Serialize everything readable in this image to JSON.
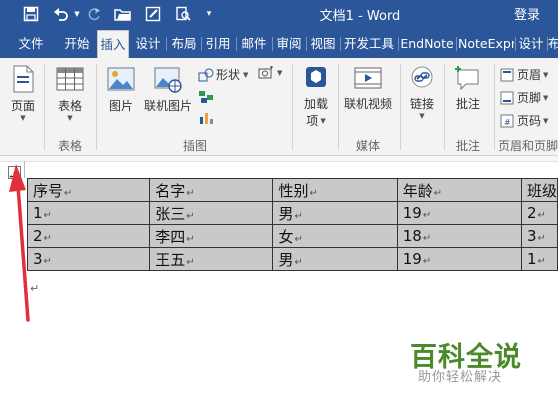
{
  "window": {
    "title": "文档1 - Word",
    "login": "登录"
  },
  "tabs": [
    {
      "label": "文件"
    },
    {
      "label": "开始"
    },
    {
      "label": "插入"
    },
    {
      "label": "设计"
    },
    {
      "label": "布局"
    },
    {
      "label": "引用"
    },
    {
      "label": "邮件"
    },
    {
      "label": "审阅"
    },
    {
      "label": "视图"
    },
    {
      "label": "开发工具"
    },
    {
      "label": "EndNote"
    },
    {
      "label": "NoteExpr"
    },
    {
      "label": "设计"
    },
    {
      "label": "布"
    }
  ],
  "active_tab": "插入",
  "ribbon": {
    "page": "页面",
    "table": "表格",
    "picture": "图片",
    "online_picture": "联机图片",
    "shapes": "形状",
    "addins": [
      "加载",
      "项"
    ],
    "online_video": "联机视频",
    "link": "链接",
    "comment": "批注",
    "header": "页眉",
    "footer": "页脚",
    "page_number": "页码",
    "groups": {
      "tables": "表格",
      "illustrations": "插图",
      "media": "媒体",
      "comments": "批注",
      "header_footer": "页眉和页脚"
    }
  },
  "table": {
    "header": [
      "序号",
      "名字",
      "性别",
      "年龄",
      "班级"
    ],
    "rows": [
      [
        "1",
        "张三",
        "男",
        "19",
        "2"
      ],
      [
        "2",
        "李四",
        "女",
        "18",
        "3"
      ],
      [
        "3",
        "王五",
        "男",
        "19",
        "1"
      ]
    ]
  },
  "watermark": {
    "title": "百科全说",
    "subtitle": "助你轻松解决"
  },
  "colors": {
    "accent": "#2b579a",
    "table_fill": "#c9c9c9",
    "arrow": "#e0303a",
    "brand": "#4a8a2a"
  }
}
